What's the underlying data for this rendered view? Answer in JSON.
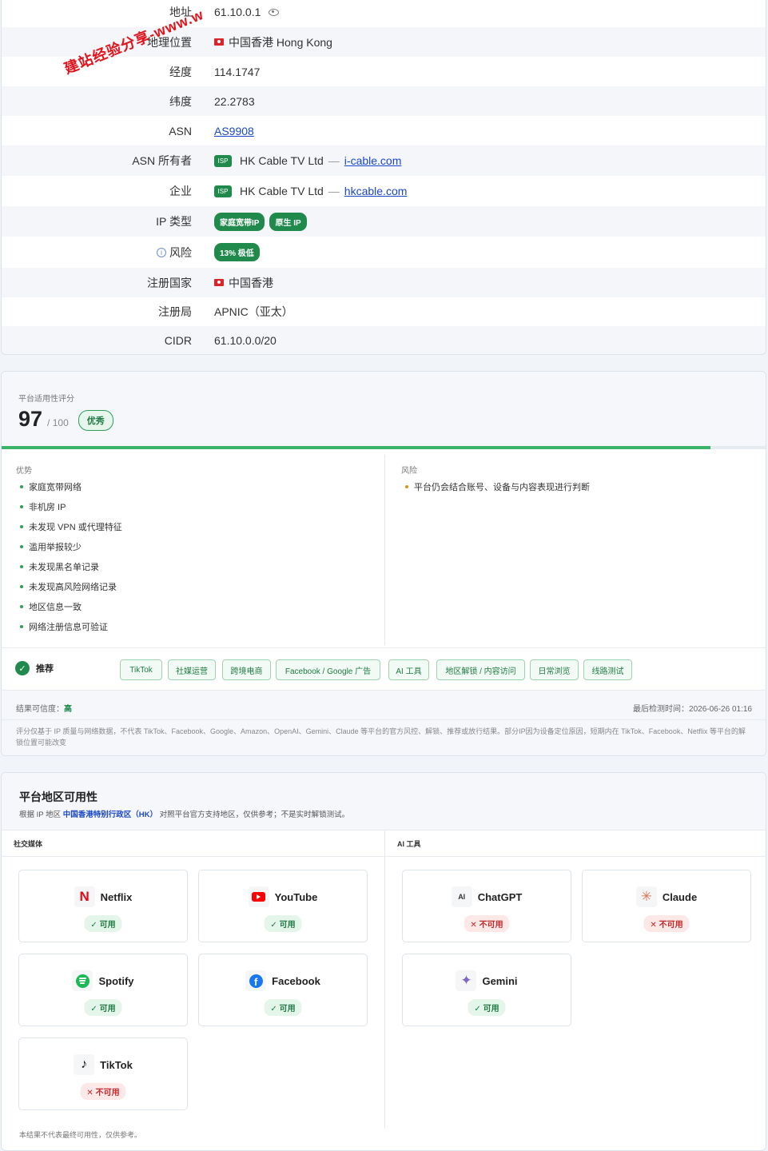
{
  "watermark": "建站经验分享-www.w",
  "info": {
    "rows": [
      {
        "label": "地址",
        "value": "61.10.0.1"
      },
      {
        "label": "地理位置",
        "value": "中国香港 Hong Kong"
      },
      {
        "label": "经度",
        "value": "114.1747"
      },
      {
        "label": "纬度",
        "value": "22.2783"
      },
      {
        "label": "ASN",
        "value": "AS9908"
      },
      {
        "label": "ASN 所有者",
        "badge": "ISP",
        "value": "HK Cable TV Ltd",
        "sep": "—",
        "link": "i-cable.com"
      },
      {
        "label": "企业",
        "badge": "ISP",
        "value": "HK Cable TV Ltd",
        "sep": "—",
        "link": "hkcable.com"
      },
      {
        "label": "IP 类型",
        "tags": [
          "家庭宽带IP",
          "原生 IP"
        ]
      },
      {
        "label": "风险",
        "tag": "13% 极低"
      },
      {
        "label": "注册国家",
        "value": "中国香港"
      },
      {
        "label": "注册局",
        "value": "APNIC（亚太）"
      },
      {
        "label": "CIDR",
        "value": "61.10.0.0/20"
      }
    ]
  },
  "score": {
    "title": "平台适用性评分",
    "value": "97",
    "max": "/ 100",
    "grade": "优秀",
    "progress": 0.97,
    "pros_title": "优势",
    "pros": [
      "家庭宽带网络",
      "非机房 IP",
      "未发现 VPN 或代理特征",
      "滥用举报较少",
      "未发现黑名单记录",
      "未发现高风险网络记录",
      "地区信息一致",
      "网络注册信息可验证"
    ],
    "risks_title": "风险",
    "risks": [
      "平台仍会结合账号、设备与内容表现进行判断"
    ],
    "recommend_label": "推荐",
    "recommend_tags": [
      "TikTok",
      "社媒运营",
      "跨境电商",
      "Facebook / Google 广告",
      "AI 工具",
      "地区解锁 / 内容访问",
      "日常浏览",
      "线路测试"
    ],
    "confidence_label": "结果可信度：",
    "confidence_value": "高",
    "last_check": "最后检测时间：2026-06-26 01:16",
    "disclaimer": "评分仅基于 IP 质量与网络数据，不代表 TikTok、Facebook、Google、Amazon、OpenAI、Gemini、Claude 等平台的官方风控、解锁、推荐或放行结果。部分IP因为设备定位原因，短期内在 TikTok、Facebook、Netflix 等平台的解锁位置可能改变"
  },
  "availability": {
    "title": "平台地区可用性",
    "desc_prefix": "根据 IP 地区",
    "region": "中国香港特别行政区（HK）",
    "desc_suffix": "对照平台官方支持地区，仅供参考；不是实时解锁测试。",
    "social_title": "社交媒体",
    "ai_title": "AI 工具",
    "social": [
      {
        "name": "Netflix",
        "icon": "netflix-icon",
        "status": "✓ 可用",
        "ok": true
      },
      {
        "name": "YouTube",
        "icon": "youtube-icon",
        "status": "✓ 可用",
        "ok": true
      },
      {
        "name": "Spotify",
        "icon": "spotify-icon",
        "status": "✓ 可用",
        "ok": true
      },
      {
        "name": "Facebook",
        "icon": "facebook-icon",
        "status": "✓ 可用",
        "ok": true
      },
      {
        "name": "TikTok",
        "icon": "tiktok-icon",
        "status": "✕ 不可用",
        "ok": false
      }
    ],
    "ai": [
      {
        "name": "ChatGPT",
        "icon": "chatgpt-icon",
        "status": "✕ 不可用",
        "ok": false
      },
      {
        "name": "Claude",
        "icon": "claude-icon",
        "status": "✕ 不可用",
        "ok": false
      },
      {
        "name": "Gemini",
        "icon": "gemini-icon",
        "status": "✓ 可用",
        "ok": true
      }
    ],
    "footnote": "本结果不代表最终可用性，仅供参考。"
  },
  "colors": {
    "green": "#1f8a4c",
    "red": "#d9252a",
    "link": "#1a47c9"
  }
}
